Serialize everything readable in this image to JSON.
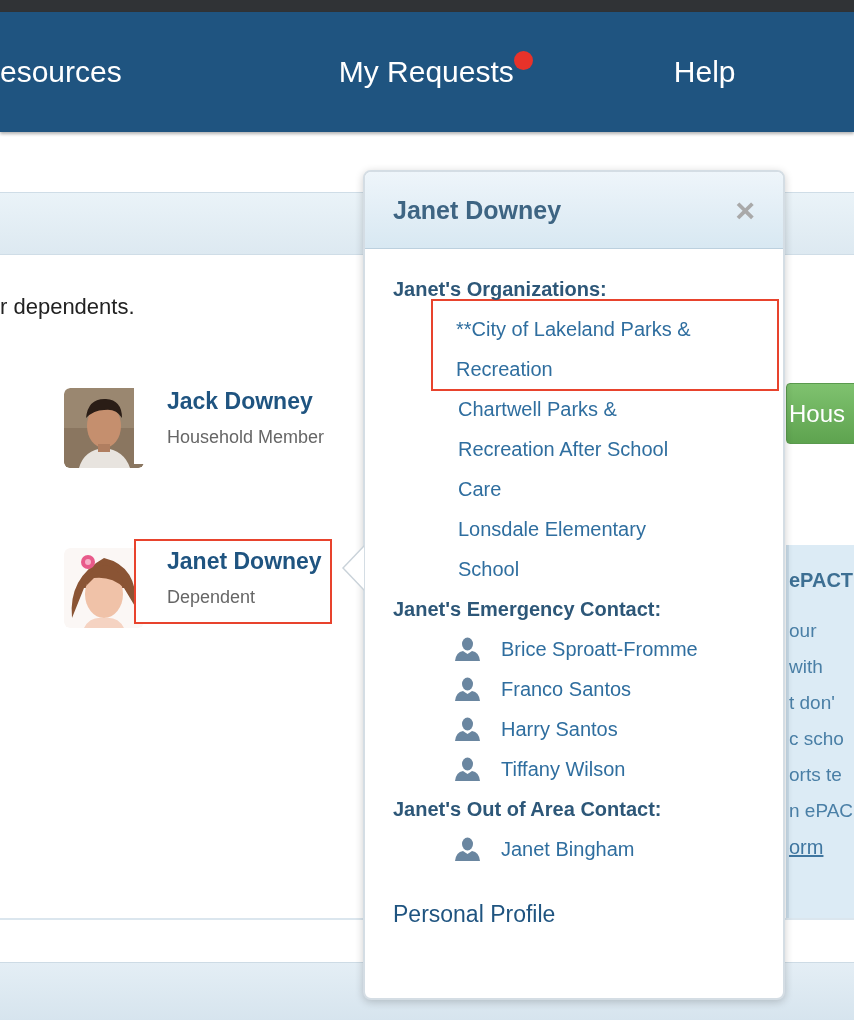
{
  "nav": {
    "items": [
      {
        "label": "esources",
        "badge": false
      },
      {
        "label": "My Requests",
        "badge": true
      },
      {
        "label": "Help",
        "badge": false
      }
    ]
  },
  "intro": "r dependents.",
  "members": [
    {
      "name": "Jack Downey",
      "role": "Household Member",
      "highlighted": false
    },
    {
      "name": "Janet Downey",
      "role": "Dependent",
      "highlighted": true
    }
  ],
  "side_button": "Hous",
  "side_panel": {
    "title": "ePACT",
    "lines": [
      "our",
      "with",
      "t don'",
      "c scho",
      "orts te",
      "n ePAC"
    ],
    "link": "orm"
  },
  "popup": {
    "title": "Janet Downey",
    "close": "×",
    "sections": [
      {
        "heading": "Janet's Organizations:",
        "kind": "org",
        "items": [
          {
            "label": "**City of Lakeland Parks & Recreation",
            "highlighted": true
          },
          {
            "label": "Chartwell Parks & Recreation After School Care",
            "highlighted": false
          },
          {
            "label": "Lonsdale Elementary School",
            "highlighted": false
          }
        ]
      },
      {
        "heading": "Janet's Emergency Contact:",
        "kind": "contact",
        "items": [
          {
            "label": "Brice Sproatt-Fromme"
          },
          {
            "label": "Franco Santos"
          },
          {
            "label": "Harry Santos"
          },
          {
            "label": "Tiffany Wilson"
          }
        ]
      },
      {
        "heading": "Janet's Out of Area Contact:",
        "kind": "contact",
        "items": [
          {
            "label": "Janet Bingham"
          }
        ]
      }
    ],
    "footer_link": "Personal Profile"
  }
}
